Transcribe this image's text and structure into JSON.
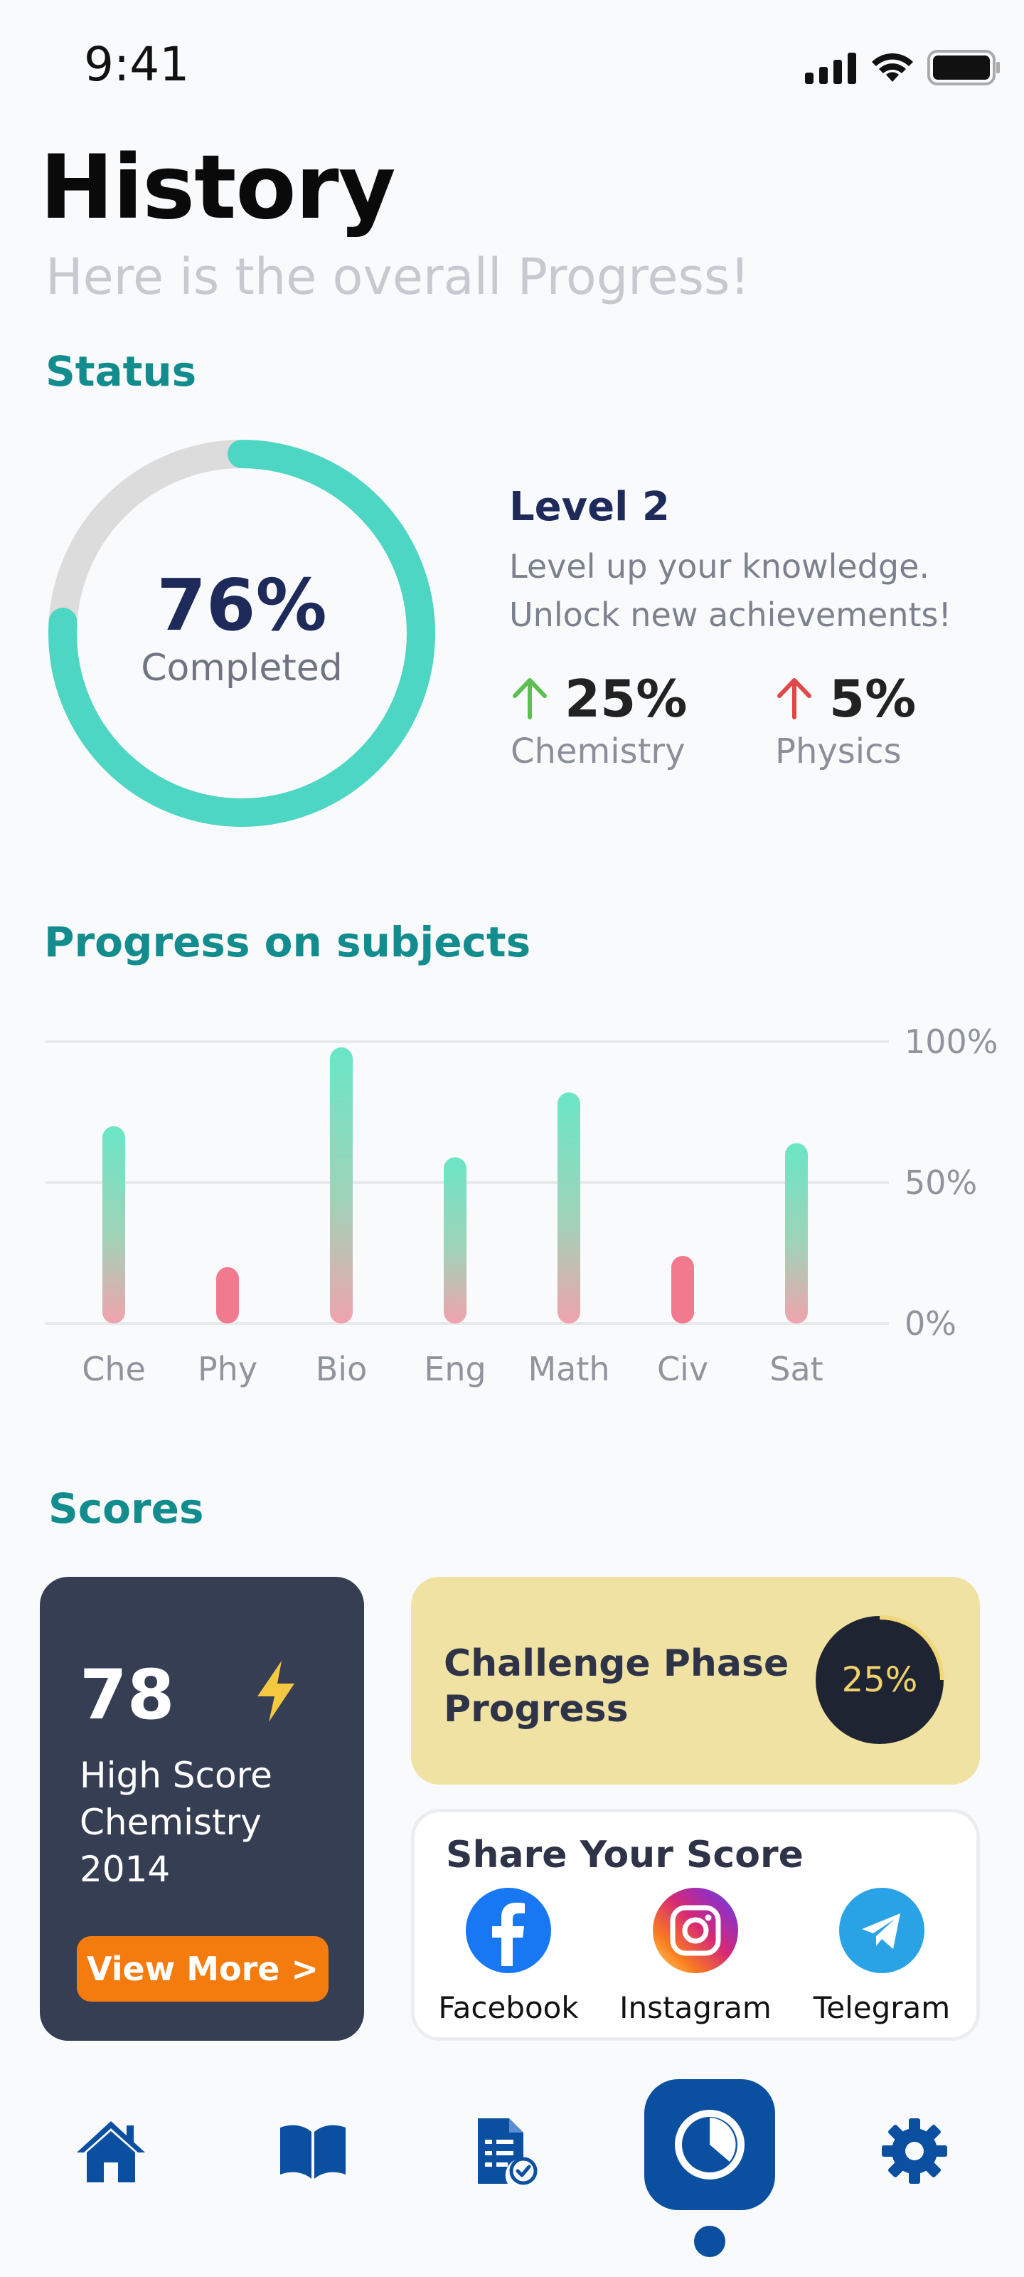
{
  "status_bar": {
    "time": "9:41"
  },
  "header": {
    "title": "History",
    "subtitle": "Here is the overall  Progress!"
  },
  "status": {
    "section_title": "Status",
    "donut": {
      "percent_text": "76%",
      "percent_value": 76,
      "label": "Completed"
    },
    "level": {
      "title": "Level 2",
      "description_line1": "Level up your knowledge.",
      "description_line2": "Unlock new achievements!"
    },
    "stats": [
      {
        "value": "25%",
        "name": "Chemistry",
        "arrow": "up",
        "color": "#5cc050"
      },
      {
        "value": "5%",
        "name": "Physics",
        "arrow": "up",
        "color": "#e04848"
      }
    ]
  },
  "progress": {
    "section_title": "Progress on subjects",
    "chart_data": {
      "type": "bar",
      "categories": [
        "Che",
        "Phy",
        "Bio",
        "Eng",
        "Math",
        "Civ",
        "Sat"
      ],
      "values": [
        70,
        20,
        98,
        59,
        82,
        24,
        64
      ],
      "y_ticks": [
        "100%",
        "50%",
        "0%"
      ],
      "ylim": [
        0,
        100
      ],
      "grid": true,
      "colors": {
        "high": "#6ae6c6",
        "low": "#f27a8e"
      }
    }
  },
  "scores": {
    "section_title": "Scores",
    "high_score": {
      "value": "78",
      "line1": "High Score",
      "line2": "Chemistry",
      "line3": "2014",
      "button": "View More >"
    },
    "challenge": {
      "line1": "Challenge Phase",
      "line2": "Progress",
      "percent_text": "25%",
      "percent_value": 25
    },
    "share": {
      "title": "Share Your Score",
      "items": [
        {
          "label": "Facebook",
          "icon": "facebook-icon",
          "color": "#1877f2"
        },
        {
          "label": "Instagram",
          "icon": "instagram-icon",
          "color": "#e1306c"
        },
        {
          "label": "Telegram",
          "icon": "telegram-icon",
          "color": "#2aa3e6"
        }
      ]
    }
  },
  "nav": {
    "items": [
      "home-icon",
      "book-icon",
      "report-icon",
      "history-icon",
      "settings-icon"
    ],
    "active": "history-icon",
    "color": "#0a4fa0"
  }
}
